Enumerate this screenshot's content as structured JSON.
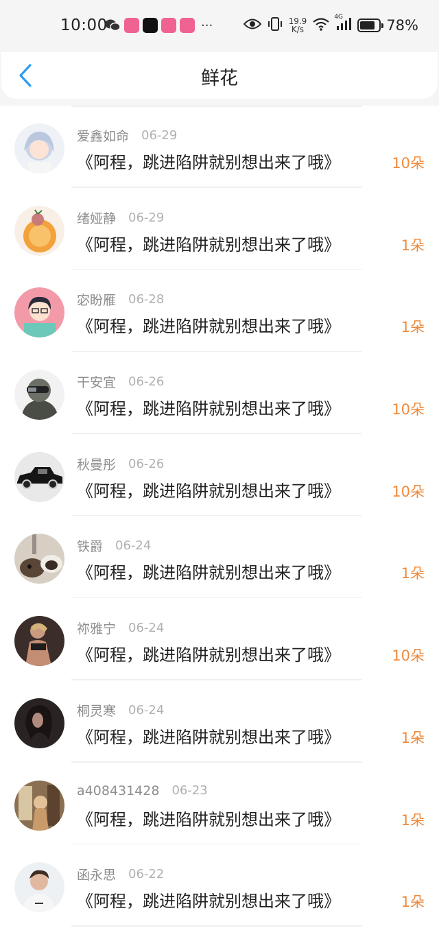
{
  "status": {
    "time": "10:00",
    "speed_value": "19.9",
    "speed_unit": "K/s",
    "network": "4G",
    "battery": "78%",
    "battery_level": 0.78
  },
  "header": {
    "title": "鲜花"
  },
  "colors": {
    "accent_blue": "#2f9bf0",
    "count_orange": "#f08a3c"
  },
  "items": [
    {
      "name": "爱鑫如命",
      "date": "06-29",
      "comment": "《阿程，跳进陷阱就别想出来了哦》",
      "count": "10朵",
      "avatar": "anime-girl-avatar"
    },
    {
      "name": "绪娅静",
      "date": "06-29",
      "comment": "《阿程，跳进陷阱就别想出来了哦》",
      "count": "1朵",
      "avatar": "fruit-avatar"
    },
    {
      "name": "宓盼雁",
      "date": "06-28",
      "comment": "《阿程，跳进陷阱就别想出来了哦》",
      "count": "1朵",
      "avatar": "cartoon-boy-avatar"
    },
    {
      "name": "干安宜",
      "date": "06-26",
      "comment": "《阿程，跳进陷阱就别想出来了哦》",
      "count": "10朵",
      "avatar": "soldier-avatar"
    },
    {
      "name": "秋曼彤",
      "date": "06-26",
      "comment": "《阿程，跳进陷阱就别想出来了哦》",
      "count": "10朵",
      "avatar": "car-avatar"
    },
    {
      "name": "铁爵",
      "date": "06-24",
      "comment": "《阿程，跳进陷阱就别想出来了哦》",
      "count": "1朵",
      "avatar": "dog-avatar"
    },
    {
      "name": "祢雅宁",
      "date": "06-24",
      "comment": "《阿程，跳进陷阱就别想出来了哦》",
      "count": "10朵",
      "avatar": "fitness-avatar"
    },
    {
      "name": "桐灵寒",
      "date": "06-24",
      "comment": "《阿程，跳进陷阱就别想出来了哦》",
      "count": "1朵",
      "avatar": "dark-portrait-avatar"
    },
    {
      "name": "a408431428",
      "date": "06-23",
      "comment": "《阿程，跳进陷阱就别想出来了哦》",
      "count": "1朵",
      "avatar": "room-photo-avatar"
    },
    {
      "name": "函永思",
      "date": "06-22",
      "comment": "《阿程，跳进陷阱就别想出来了哦》",
      "count": "1朵",
      "avatar": "man-portrait-avatar"
    }
  ]
}
